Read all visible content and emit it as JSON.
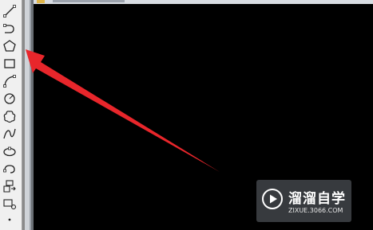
{
  "toolbar": {
    "tools": [
      {
        "icon": "line-icon"
      },
      {
        "icon": "polyline-icon"
      },
      {
        "icon": "polygon-icon"
      },
      {
        "icon": "rectangle-icon"
      },
      {
        "icon": "arc-icon"
      },
      {
        "icon": "circle-icon"
      },
      {
        "icon": "revision-cloud-icon"
      },
      {
        "icon": "spline-icon"
      },
      {
        "icon": "ellipse-icon"
      },
      {
        "icon": "ellipse-arc-icon"
      },
      {
        "icon": "insert-block-icon"
      },
      {
        "icon": "make-block-icon"
      },
      {
        "icon": "point-icon"
      }
    ]
  },
  "annotation": {
    "arrow_color": "#e8262b"
  },
  "watermark": {
    "name": "溜溜自学",
    "url": "ZIXUE.3066.COM"
  }
}
